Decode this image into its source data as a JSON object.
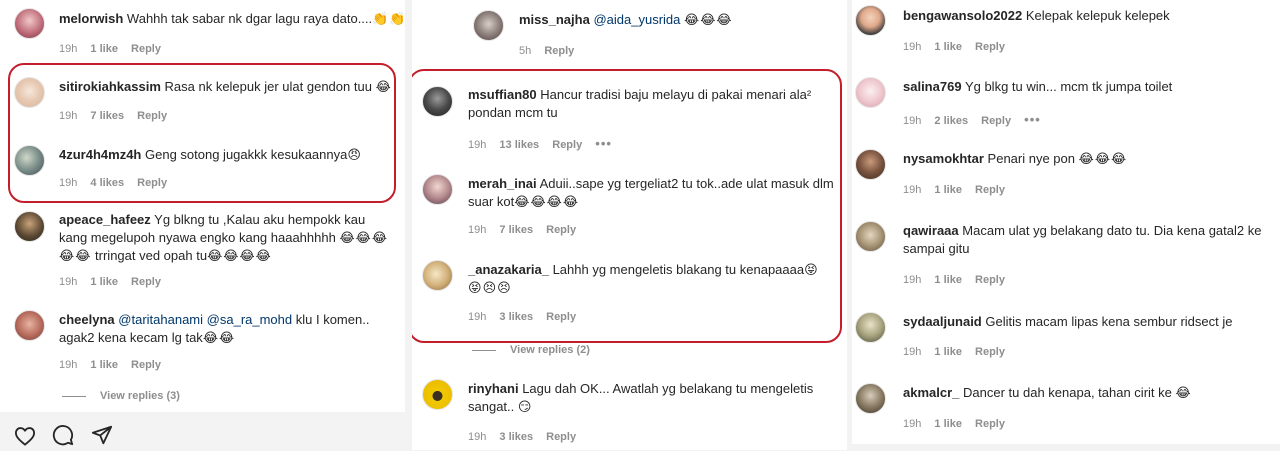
{
  "columns": [
    {
      "comments": [
        {
          "username": "melorwish",
          "text": "Wahhh tak sabar nk dgar lagu raya dato....",
          "emojis": [
            "👏",
            "👏",
            "👏"
          ],
          "time": "19h",
          "likes": "1 like",
          "reply": "Reply"
        },
        {
          "username": "sitirokiahkassim",
          "text": "Rasa nk kelepuk jer ulat gendon tuu",
          "emojis": [
            "😂"
          ],
          "time": "19h",
          "likes": "7 likes",
          "reply": "Reply"
        },
        {
          "username": "4zur4h4mz4h",
          "text": "Geng sotong jugakkk kesukaannya",
          "emojis": [
            "😠"
          ],
          "time": "19h",
          "likes": "4 likes",
          "reply": "Reply"
        },
        {
          "username": "apeace_hafeez",
          "text": "Yg blkng tu ,Kalau aku hempokk kau kang megelupoh nyawa engko kang haaahhhhh",
          "emojis": [
            "😂",
            "😂",
            "😂",
            "😂",
            "😂"
          ],
          "text2": "trringat ved opah tu",
          "emojis2": [
            "😂",
            "😂",
            "😂",
            "😂"
          ],
          "time": "19h",
          "likes": "1 like",
          "reply": "Reply"
        },
        {
          "username": "cheelyna",
          "mention1": "@taritahanami",
          "mention2": "@sa_ra_mohd",
          "text": "klu I komen.. agak2 kena kecam lg tak",
          "emojis": [
            "😂",
            "😂"
          ],
          "time": "19h",
          "likes": "1 like",
          "reply": "Reply",
          "view_replies": "View replies (3)"
        }
      ]
    },
    {
      "comments": [
        {
          "username": "miss_najha",
          "mention": "@aida_yusrida",
          "emojis": [
            "😂",
            "😂",
            "😂"
          ],
          "time": "5h",
          "reply": "Reply"
        },
        {
          "username": "msuffian80",
          "text": "Hancur tradisi baju melayu di pakai menari ala² pondan mcm tu",
          "time": "19h",
          "likes": "13 likes",
          "reply": "Reply",
          "more": "•••"
        },
        {
          "username": "merah_inai",
          "text": "Aduii..sape yg tergeliat2 tu tok..ade ulat masuk dlm suar kot",
          "emojis": [
            "😂",
            "😂",
            "😂",
            "😂"
          ],
          "time": "19h",
          "likes": "7 likes",
          "reply": "Reply"
        },
        {
          "username": "_anazakaria_",
          "text": "Lahhh yg mengeletis blakang tu kenapaaaa",
          "emojis": [
            "😝",
            "😝",
            "😣",
            "😣"
          ],
          "time": "19h",
          "likes": "3 likes",
          "reply": "Reply",
          "view_replies": "View replies (2)"
        },
        {
          "username": "rinyhani",
          "text": "Lagu dah OK... Awatlah yg belakang tu mengeletis sangat..",
          "emojis": [
            "😏"
          ],
          "time": "19h",
          "likes": "3 likes",
          "reply": "Reply"
        }
      ]
    },
    {
      "comments": [
        {
          "username": "bengawansolo2022",
          "text": "Kelepak kelepuk kelepek",
          "time": "19h",
          "likes": "1 like",
          "reply": "Reply"
        },
        {
          "username": "salina769",
          "text": "Yg blkg tu win... mcm tk jumpa toilet",
          "time": "19h",
          "likes": "2 likes",
          "reply": "Reply",
          "more": "•••"
        },
        {
          "username": "nysamokhtar",
          "text": "Penari nye pon",
          "emojis": [
            "😂",
            "😂",
            "😂"
          ],
          "time": "19h",
          "likes": "1 like",
          "reply": "Reply"
        },
        {
          "username": "qawiraaa",
          "text": "Macam ulat yg belakang dato tu. Dia kena gatal2 ke sampai gitu",
          "time": "19h",
          "likes": "1 like",
          "reply": "Reply"
        },
        {
          "username": "sydaaljunaid",
          "text": "Gelitis macam lipas kena sembur ridsect je",
          "time": "19h",
          "likes": "1 like",
          "reply": "Reply"
        },
        {
          "username": "akmalcr_",
          "text": "Dancer tu dah kenapa, tahan cirit ke",
          "emojis": [
            "😂"
          ],
          "time": "19h",
          "likes": "1 like",
          "reply": "Reply"
        }
      ]
    }
  ],
  "actions": {
    "like": "heart-icon",
    "comment": "comment-icon",
    "share": "share-icon"
  },
  "colors": {
    "highlight": "#c41e2a",
    "mention": "#00376b",
    "meta": "#8e8e8e"
  }
}
